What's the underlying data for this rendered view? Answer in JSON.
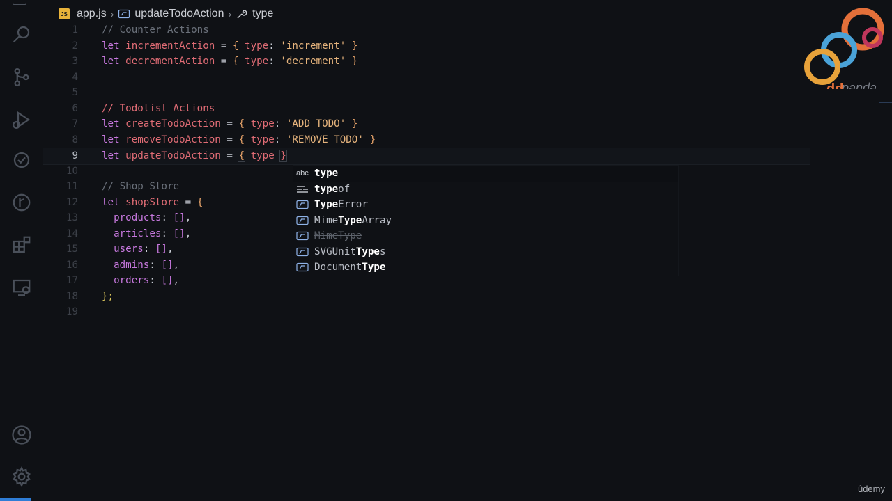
{
  "breadcrumb": {
    "file_badge": "JS",
    "file": "app.js",
    "symbol": "updateTodoAction",
    "property": "type"
  },
  "activity_bar": {
    "items": [
      "explorer-icon",
      "search-icon",
      "source-control-icon",
      "run-debug-icon",
      "remote-icon",
      "git-graph-icon",
      "extensions-icon",
      "remote-explorer-icon"
    ],
    "bottom": [
      "account-icon",
      "settings-gear-icon"
    ]
  },
  "editor": {
    "lines": [
      {
        "n": "1",
        "text": "// Counter Actions"
      },
      {
        "n": "2",
        "text": "let incrementAction = { type: 'increment' }"
      },
      {
        "n": "3",
        "text": "let decrementAction = { type: 'decrement' }"
      },
      {
        "n": "4",
        "text": ""
      },
      {
        "n": "5",
        "text": ""
      },
      {
        "n": "6",
        "text": "// Todolist Actions"
      },
      {
        "n": "7",
        "text": "let createTodoAction = { type: 'ADD_TODO' }"
      },
      {
        "n": "8",
        "text": "let removeTodoAction = { type: 'REMOVE_TODO' }"
      },
      {
        "n": "9",
        "text": "let updateTodoAction = { type }"
      },
      {
        "n": "10",
        "text": ""
      },
      {
        "n": "11",
        "text": "// Shop Store"
      },
      {
        "n": "12",
        "text": "let shopStore = {"
      },
      {
        "n": "13",
        "text": "products: [],"
      },
      {
        "n": "14",
        "text": "articles: [],"
      },
      {
        "n": "15",
        "text": "users: [],"
      },
      {
        "n": "16",
        "text": "admins: [],"
      },
      {
        "n": "17",
        "text": "orders: [],"
      },
      {
        "n": "18",
        "text": "};"
      },
      {
        "n": "19",
        "text": ""
      }
    ],
    "tokens": {
      "let": "let",
      "eq": "=",
      "open": "{",
      "close": "}",
      "type": "type",
      "colon": ":",
      "incrementAction": "incrementAction",
      "decrementAction": "decrementAction",
      "increment": "'increment'",
      "decrement": "'decrement'",
      "createTodoAction": "createTodoAction",
      "removeTodoAction": "removeTodoAction",
      "updateTodoAction": "updateTodoAction",
      "add_todo": "'ADD_TODO'",
      "remove_todo": "'REMOVE_TODO'",
      "comment_counter": "// Counter Actions",
      "comment_todo": "// Todolist Actions",
      "comment_shop": "// Shop Store",
      "shopStore": "shopStore",
      "products": "products",
      "articles": "articles",
      "users": "users",
      "admins": "admins",
      "orders": "orders",
      "empty_arr": "[]",
      "comma": ",",
      "end": "};"
    }
  },
  "suggestions": {
    "items": [
      {
        "kind": "abc",
        "match": "type",
        "rest": "",
        "prefix": "",
        "deprecated": false
      },
      {
        "kind": "keyword-icon",
        "match": "type",
        "rest": "of",
        "prefix": "",
        "deprecated": false
      },
      {
        "kind": "variable-icon",
        "match": "Type",
        "rest": "Error",
        "prefix": "",
        "deprecated": false
      },
      {
        "kind": "variable-icon",
        "match": "Type",
        "rest": "Array",
        "prefix": "Mime",
        "deprecated": false
      },
      {
        "kind": "variable-icon",
        "match": "",
        "rest": "MimeType",
        "prefix": "",
        "deprecated": true
      },
      {
        "kind": "variable-icon",
        "match": "Type",
        "rest": "s",
        "prefix": "SVGUnit",
        "deprecated": false
      },
      {
        "kind": "variable-icon",
        "match": "Type",
        "rest": "",
        "prefix": "Document",
        "deprecated": false
      }
    ]
  },
  "watermark": {
    "logo_text": "ddpanda",
    "udemy": "ûdemy"
  },
  "colors": {
    "accent": "#2f7dd6",
    "keyword": "#c678dd",
    "variable": "#e06c75",
    "string": "#e5b37c",
    "comment": "#d17a5b"
  }
}
